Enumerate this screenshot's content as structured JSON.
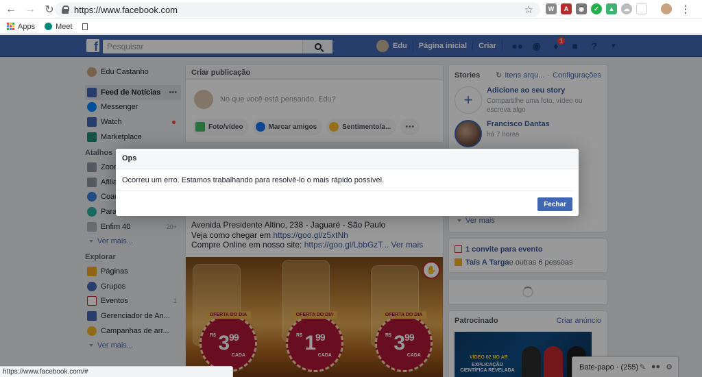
{
  "browser": {
    "url": "https://www.facebook.com",
    "bookmarks": [
      {
        "label": "Apps"
      },
      {
        "label": "Meet"
      },
      {
        "label": ""
      }
    ],
    "status_url": "https://www.facebook.com/#"
  },
  "header": {
    "search_placeholder": "Pesquisar",
    "user_name": "Edu",
    "home_label": "Página inicial",
    "create_label": "Criar",
    "notification_count": "1"
  },
  "sidebar": {
    "profile_name": "Edu Castanho",
    "items": [
      {
        "label": "Feed de Notícias"
      },
      {
        "label": "Messenger"
      },
      {
        "label": "Watch"
      },
      {
        "label": "Marketplace"
      }
    ],
    "shortcuts_title": "Atalhos",
    "shortcuts": [
      {
        "label": "Zoom"
      },
      {
        "label": "Afiliados"
      },
      {
        "label": "Coach"
      },
      {
        "label": "Para"
      },
      {
        "label": "Enfim 40",
        "count": "20+"
      }
    ],
    "see_more": "Ver mais...",
    "explore_title": "Explorar",
    "explore": [
      {
        "label": "Páginas"
      },
      {
        "label": "Grupos"
      },
      {
        "label": "Eventos",
        "count": "1"
      },
      {
        "label": "Gerenciador de An..."
      },
      {
        "label": "Campanhas de arr..."
      }
    ],
    "see_more_2": "Ver mais..."
  },
  "composer": {
    "title": "Criar publicação",
    "prompt": "No que você está pensando, Edu?",
    "actions": [
      {
        "label": "Foto/vídeo"
      },
      {
        "label": "Marcar amigos"
      },
      {
        "label": "Sentimento/a..."
      }
    ],
    "more": "•••"
  },
  "post": {
    "line1": "Avenida Presidente Altino, 238 - Jaguaré - São Paulo",
    "line2_prefix": "Veja como chegar em ",
    "line2_link": "https://goo.gl/z5xtNh",
    "line3_prefix": "Compre Online em nosso site: ",
    "line3_link": "https://goo.gl/LbbGzT...",
    "line3_more": "Ver mais",
    "offer_label": "OFERTA DO DIA",
    "currency": "R$",
    "unit": "CADA",
    "prices": [
      {
        "int": "3",
        "dec": "99"
      },
      {
        "int": "1",
        "dec": "99"
      },
      {
        "int": "3",
        "dec": "99"
      }
    ]
  },
  "stories": {
    "title": "Stories",
    "archive_link": "Itens arqu...",
    "separator": "·",
    "settings_link": "Configurações",
    "add_title": "Adicione ao seu story",
    "add_sub": "Compartilhe uma foto, vídeo ou escreva algo",
    "friend_name": "Francisco Dantas",
    "friend_time": "há 7 horas",
    "see_more": "Ver mais"
  },
  "events": {
    "invite": "1 convite para evento",
    "birthday_name": "Taís A Targa",
    "birthday_rest": " e outras 6 pessoas"
  },
  "sponsored": {
    "title": "Patrocinado",
    "create_ad": "Criar anúncio",
    "ad_line1": "VÍDEO 02 NO AR",
    "ad_line2": "EXPLICAÇÃO CIENTÍFICA REVELADA"
  },
  "chat": {
    "label": "Bate-papo · (255)"
  },
  "dialog": {
    "title": "Ops",
    "message": "Ocorreu um erro. Estamos trabalhando para resolvê-lo o mais rápido possível.",
    "close_button": "Fechar"
  },
  "colors": {
    "fb_blue": "#4267b2",
    "link": "#365899",
    "notification": "#fa3e3e"
  }
}
